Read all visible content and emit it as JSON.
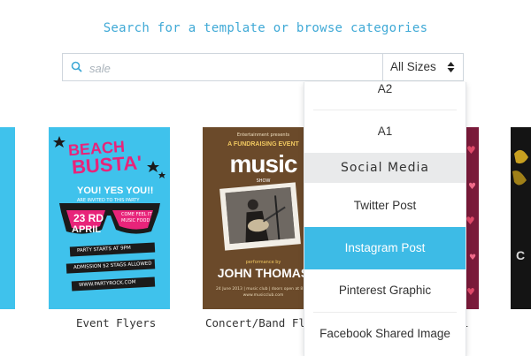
{
  "headline": "Search for a template or browse categories",
  "search": {
    "placeholder": "sale",
    "size_selected": "All Sizes"
  },
  "categories": [
    {
      "label": "Event Flyers"
    },
    {
      "label": "Concert/Band Fly"
    },
    {
      "label": "l"
    }
  ],
  "beach_flyer": {
    "title1": "BEACH",
    "title2": "BUSTA'",
    "yes": "YOU! YES YOU!!",
    "invite": "ARE INVITED TO THIS PARTY",
    "date1": "23 RD",
    "date2": "APRIL",
    "info": "COME FEEL IT MUSIC FOOD",
    "strip1": "PARTY STARTS AT 9PM",
    "strip2": "ADMISSION $2 STAGS ALLOWED",
    "strip3": "WWW.PARTYROCK.COM"
  },
  "concert_flyer": {
    "top": "Entertainment presents",
    "fund": "A FUNDRAISING EVENT",
    "music": "music",
    "show": "SHOW",
    "perf": "performance by",
    "name": "JOHN THOMAS",
    "info1": "24 June 2013 | music club | doors open at 8 pm",
    "info2": "www.musicclub.com"
  },
  "size_dropdown": {
    "items": [
      "A2",
      "A1"
    ],
    "section_header": "Social Media",
    "social_items": [
      "Twitter Post",
      "Instagram Post",
      "Pinterest Graphic",
      "Facebook Shared Image"
    ],
    "active": "Instagram Post"
  },
  "colors": {
    "accent": "#3fa9d6",
    "active": "#3dbbe6"
  }
}
